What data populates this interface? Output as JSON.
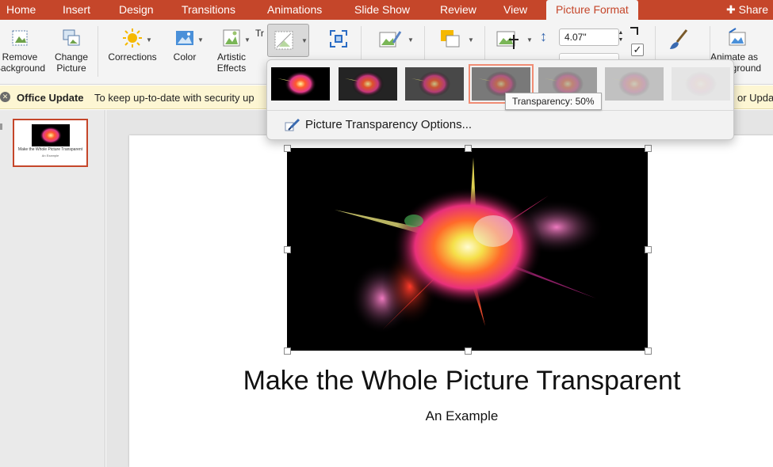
{
  "tabs": [
    {
      "label": "Home"
    },
    {
      "label": "Insert"
    },
    {
      "label": "Design"
    },
    {
      "label": "Transitions"
    },
    {
      "label": "Animations"
    },
    {
      "label": "Slide Show"
    },
    {
      "label": "Review"
    },
    {
      "label": "View"
    },
    {
      "label": "Picture Format",
      "active": true
    }
  ],
  "share_label": "Share",
  "ribbon": {
    "remove_background": "Remove\nBackground",
    "change_picture": "Change\nPicture",
    "corrections": "Corrections",
    "color": "Color",
    "artistic_effects": "Artistic\nEffects",
    "transparency_partial": "Tr",
    "height_value": "4.07\"",
    "animate_as_background": "Animate as\nBackground"
  },
  "notification": {
    "title": "Office Update",
    "message": "To keep up-to-date with security up",
    "right_text": "or Upda"
  },
  "thumbnail": {
    "title": "Make the Whole Picture Transparent",
    "subtitle": "An Example"
  },
  "slide": {
    "title": "Make the Whole Picture Transparent",
    "subtitle": "An Example"
  },
  "gallery": {
    "presets": [
      {
        "transparency": 0
      },
      {
        "transparency": 15
      },
      {
        "transparency": 30
      },
      {
        "transparency": 50,
        "selected": true
      },
      {
        "transparency": 65
      },
      {
        "transparency": 80
      },
      {
        "transparency": 95
      }
    ],
    "options_label": "Picture Transparency Options...",
    "tooltip": "Transparency: 50%"
  },
  "colors": {
    "accent": "#c5462a",
    "ribbon": "#f4f4f4",
    "notification": "#fdf6d3",
    "selection_outline": "#f08c74"
  },
  "icons": [
    "remove-background-icon",
    "change-picture-icon",
    "corrections-icon",
    "color-icon",
    "artistic-effects-icon",
    "transparency-icon",
    "compress-icon",
    "picture-styles-icon",
    "arrange-icon",
    "crop-icon",
    "height-icon",
    "brush-icon",
    "animate-background-icon",
    "close-icon",
    "transparency-options-icon"
  ]
}
